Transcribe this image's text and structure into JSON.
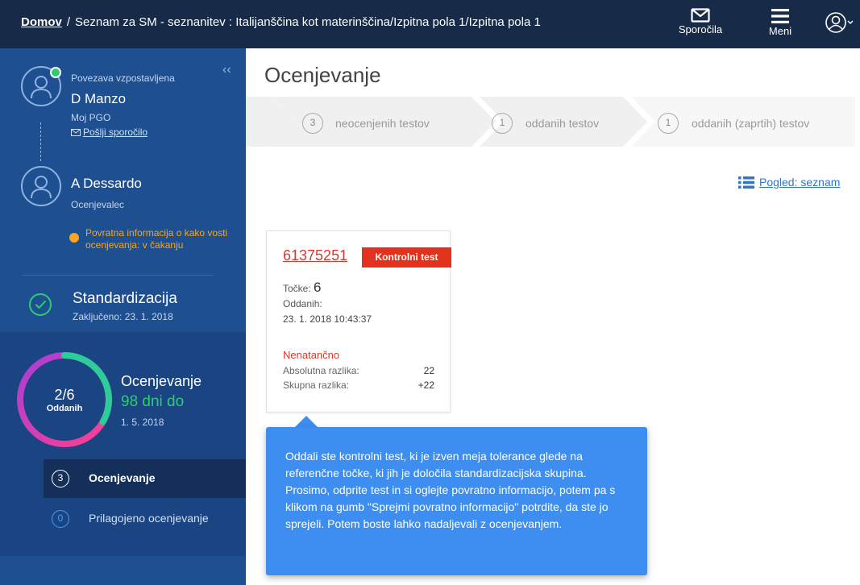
{
  "topbar": {
    "home": "Domov",
    "separator": "/",
    "path": "Seznam za SM - seznanitev : Italijanščina kot materinščina/Izpitna pola 1/Izpitna pola 1",
    "messages_label": "Sporočila",
    "menu_label": "Meni",
    "icons": [
      "envelope-icon",
      "hamburger-icon",
      "user-icon",
      "chevron-down-icon"
    ]
  },
  "sidebar": {
    "collapse_glyph": "‹‹",
    "connection_status": "Povezava vzpostavljena",
    "leader": {
      "name": "D Manzo",
      "role": "Moj PGO",
      "send_message": "Pošlji sporočilo"
    },
    "grader": {
      "name": "A Dessardo",
      "role": "Ocenjevalec",
      "feedback": "Povratna informacija o kako vosti ocenjevanja: v čakanju"
    },
    "standardization": {
      "title": "Standardizacija",
      "completed": "Zaključeno: 23. 1. 2018"
    },
    "grading": {
      "progress": "2/6",
      "progress_label": "Oddanih",
      "progress_fraction": 0.333,
      "title": "Ocenjevanje",
      "days_left": "98 dni do",
      "deadline": "1. 5. 2018"
    },
    "sub_items": [
      {
        "count": "3",
        "label": "Ocenjevanje"
      },
      {
        "count": "0",
        "label": "Prilagojeno ocenjevanje"
      }
    ]
  },
  "main": {
    "title": "Ocenjevanje",
    "steps": [
      {
        "count": "3",
        "label": "neocenjenih testov"
      },
      {
        "count": "1",
        "label": "oddanih testov"
      },
      {
        "count": "1",
        "label": "oddanih (zaprtih) testov"
      }
    ],
    "view_label": "Pogled: seznam"
  },
  "card": {
    "id": "61375251",
    "badge": "Kontrolni test",
    "points_label": "Točke:",
    "points_value": "6",
    "submitted_label": "Oddanih:",
    "submitted_date": "23. 1. 2018 10:43:37",
    "status": "Nenatančno",
    "abs_diff_label": "Absolutna razlika:",
    "abs_diff_value": "22",
    "total_diff_label": "Skupna razlika:",
    "total_diff_value": "+22"
  },
  "tooltip": {
    "text": "Oddali ste kontrolni test, ki je izven meja tolerance glede na referenčne točke, ki jih je določila standardizacijska skupina. Prosimo, odprite test in si oglejte povratno informacijo, potem pa s klikom na gumb \"Sprejmi povratno informacijo\" potrdite, da ste jo sprejeli. Potem boste lahko nadaljevali z ocenjevanjem."
  },
  "colors": {
    "topbar": "#172a47",
    "sidebar": "#1d4f91",
    "accent_green": "#2ecc71",
    "warning": "#f5a623",
    "error_red": "#e2311d",
    "tooltip_blue": "#3d8ef0",
    "link_blue": "#2b76cf"
  }
}
